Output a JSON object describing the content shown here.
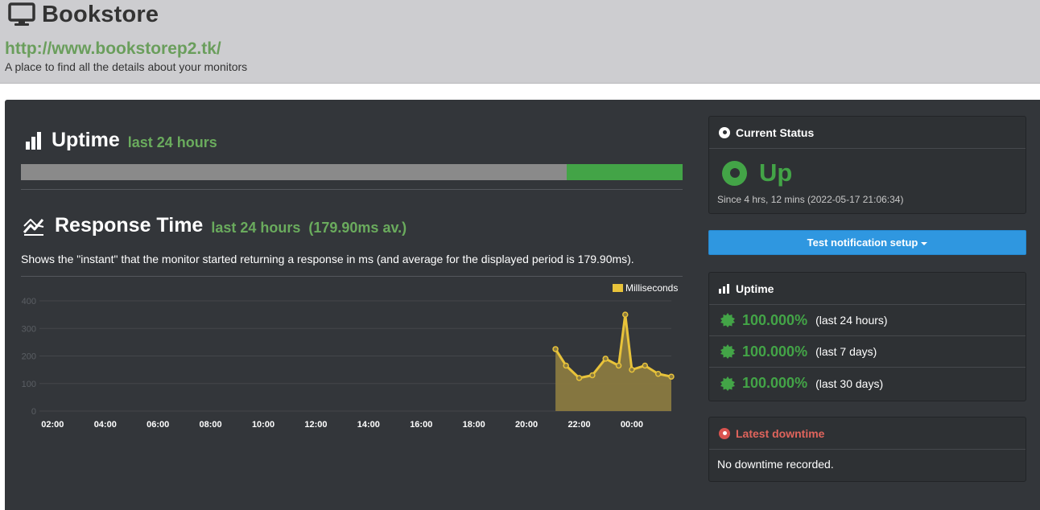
{
  "header": {
    "title": "Bookstore",
    "url": "http://www.bookstorep2.tk/",
    "tagline": "A place to find all the details about your monitors"
  },
  "uptime_section": {
    "title": "Uptime",
    "subtitle": "last 24 hours",
    "bar_up_fraction": 0.175,
    "colors": {
      "no_data": "#8a8a8a",
      "up": "#43a447"
    }
  },
  "response_section": {
    "title": "Response Time",
    "subtitle": "last 24 hours",
    "average": "(179.90ms av.)",
    "description": "Shows the \"instant\" that the monitor started returning a response in ms (and average for the displayed period is 179.90ms)."
  },
  "chart_data": {
    "type": "area",
    "series": [
      {
        "name": "Milliseconds",
        "color": "#e8c33a",
        "x": [
          "21:06",
          "21:30",
          "22:00",
          "22:30",
          "23:00",
          "23:30",
          "23:45",
          "00:00",
          "00:30",
          "01:00",
          "01:30"
        ],
        "values": [
          225,
          165,
          120,
          130,
          190,
          165,
          350,
          150,
          165,
          135,
          125
        ]
      }
    ],
    "x_ticks": [
      "02:00",
      "04:00",
      "06:00",
      "08:00",
      "10:00",
      "12:00",
      "14:00",
      "16:00",
      "18:00",
      "20:00",
      "22:00",
      "00:00"
    ],
    "y_ticks": [
      "0",
      "100",
      "200",
      "300",
      "400"
    ],
    "ylim": [
      0,
      400
    ],
    "legend": "top-right",
    "grid": true
  },
  "current_status": {
    "title": "Current Status",
    "status": "Up",
    "since": "Since 4 hrs, 12 mins (2022-05-17 21:06:34)"
  },
  "notify_button": {
    "label": "Test notification setup"
  },
  "uptime_panel": {
    "title": "Uptime",
    "rows": [
      {
        "pct": "100.000%",
        "label": "(last 24 hours)"
      },
      {
        "pct": "100.000%",
        "label": "(last 7 days)"
      },
      {
        "pct": "100.000%",
        "label": "(last 30 days)"
      }
    ]
  },
  "latest_downtime": {
    "title": "Latest downtime",
    "text": "No downtime recorded."
  }
}
